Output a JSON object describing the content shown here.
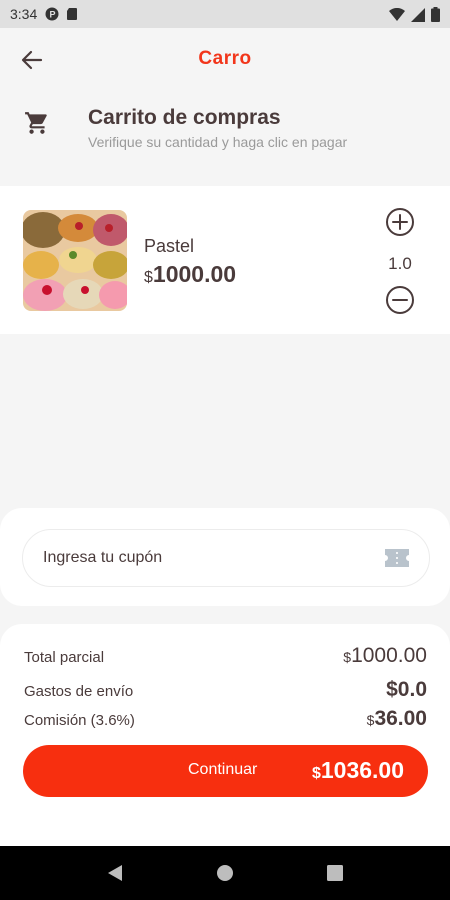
{
  "status_bar": {
    "time": "3:34"
  },
  "header": {
    "title": "Carro"
  },
  "cart": {
    "title": "Carrito de compras",
    "subtitle": "Verifique su cantidad y haga clic en pagar"
  },
  "item": {
    "name": "Pastel",
    "currency": "$",
    "price": "1000.00",
    "quantity": "1.0"
  },
  "coupon": {
    "placeholder": "Ingresa tu cupón"
  },
  "summary": {
    "subtotal_label": "Total parcial",
    "subtotal_currency": "$",
    "subtotal_value": "1000.00",
    "shipping_label": "Gastos de envío",
    "shipping_value": "$0.0",
    "commission_label": "Comisión (3.6%)",
    "commission_currency": "$",
    "commission_value": "36.00"
  },
  "continue_button": {
    "label": "Continuar",
    "currency": "$",
    "total": "1036.00"
  },
  "colors": {
    "accent": "#f2361b",
    "button": "#f72f0f",
    "text": "#4a3b3b",
    "muted": "#9a9a9a"
  }
}
